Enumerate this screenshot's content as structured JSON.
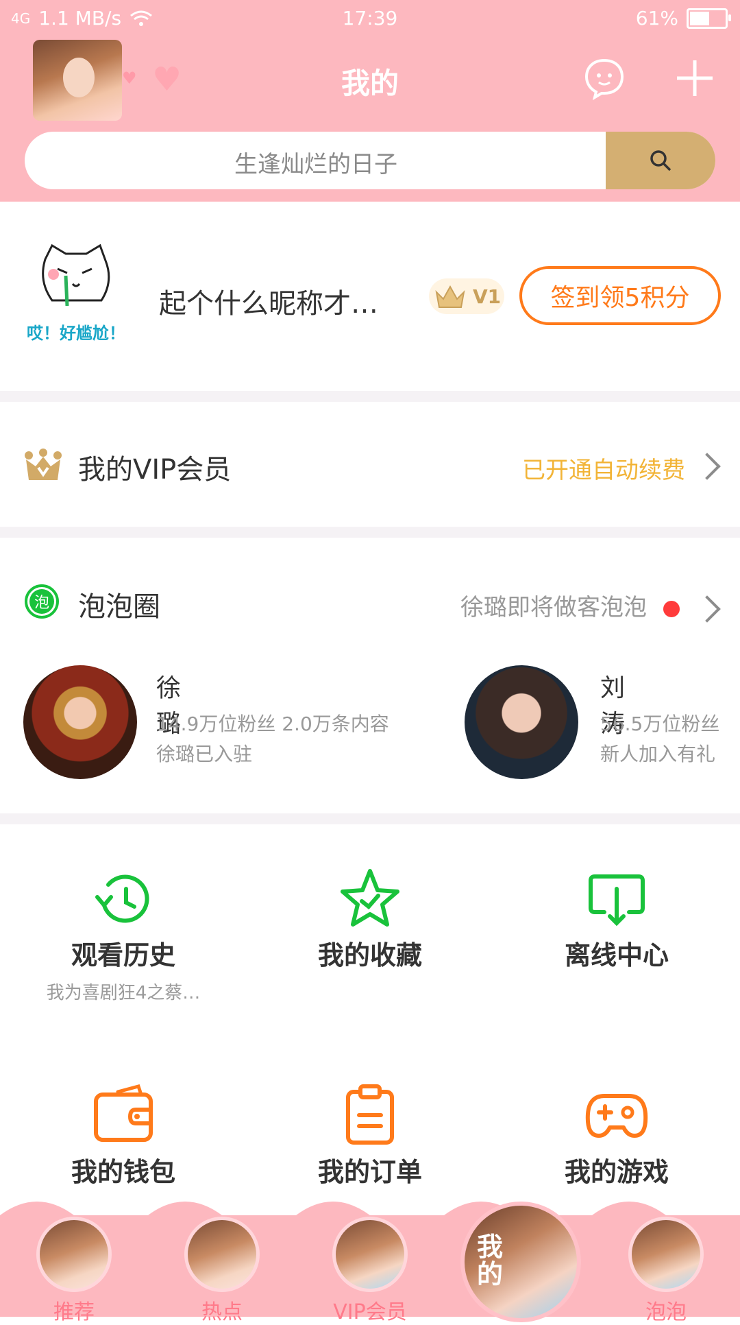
{
  "status": {
    "signal": "4G",
    "speed": "1.1 MB/s",
    "time": "17:39",
    "battery": "61%"
  },
  "header": {
    "title": "我的",
    "search_placeholder": "生逢灿烂的日子"
  },
  "profile": {
    "nickname": "起个什么昵称才…",
    "level": "V1",
    "checkin_label": "签到领5积分",
    "sticker_text": "哎！好尴尬！"
  },
  "vip": {
    "label": "我的VIP会员",
    "status": "已开通自动续费"
  },
  "bubble": {
    "label": "泡泡圈",
    "icon_text": "泡",
    "notice": "徐璐即将做客泡泡",
    "cards": [
      {
        "name": "徐璐",
        "meta1": "14.9万位粉丝  2.0万条内容",
        "meta2": "徐璐已入驻"
      },
      {
        "name": "刘涛",
        "meta1": "56.5万位粉丝",
        "meta2": "新人加入有礼"
      }
    ]
  },
  "grid": [
    {
      "label": "观看历史",
      "sub": "我为喜剧狂4之蔡…"
    },
    {
      "label": "我的收藏",
      "sub": ""
    },
    {
      "label": "离线中心",
      "sub": ""
    },
    {
      "label": "我的钱包",
      "sub": ""
    },
    {
      "label": "我的订单",
      "sub": ""
    },
    {
      "label": "我的游戏",
      "sub": ""
    }
  ],
  "nav": [
    {
      "label": "推荐"
    },
    {
      "label": "热点"
    },
    {
      "label": "VIP会员"
    },
    {
      "label": "我的"
    },
    {
      "label": "泡泡"
    }
  ],
  "colors": {
    "pink": "#fdb8bf",
    "gold": "#d4af72",
    "orange": "#ff7a1a",
    "green": "#19c23b"
  }
}
